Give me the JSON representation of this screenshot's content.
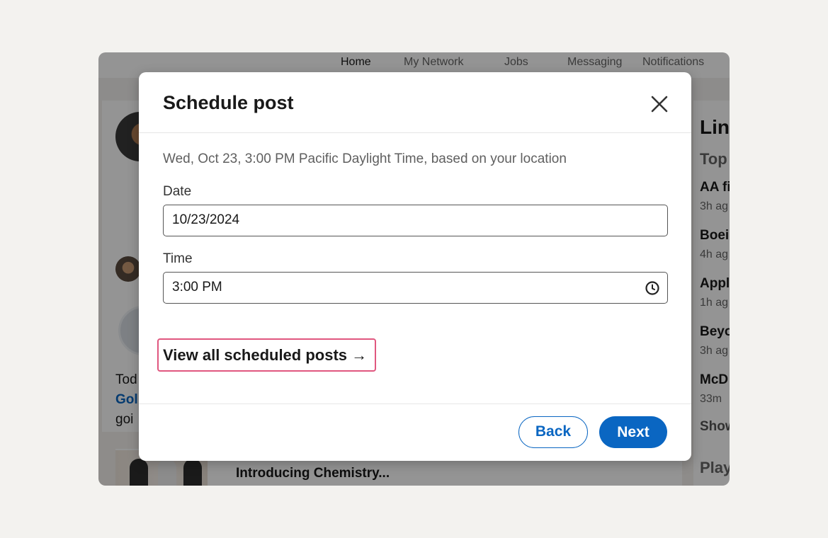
{
  "nav": {
    "items": [
      "Home",
      "My Network",
      "Jobs",
      "Messaging",
      "Notifications"
    ],
    "active": "Home"
  },
  "background": {
    "left_snippet_1": "Tod",
    "left_snippet_2": "Gol",
    "left_snippet_3": "goi",
    "feed_title": "Introducing Chemistry...",
    "right_title": "Linl",
    "right_subtitle": "Top",
    "right_items": [
      {
        "title": "AA fi",
        "time": "3h ag"
      },
      {
        "title": "Boei",
        "time": "4h ag"
      },
      {
        "title": "Appl",
        "time": "1h ag"
      },
      {
        "title": "Beyo",
        "time": "3h ag"
      },
      {
        "title": "McD",
        "time": "33m"
      }
    ],
    "right_show": "Show",
    "right_play": "Play"
  },
  "modal": {
    "title": "Schedule post",
    "timezone_note": "Wed, Oct 23, 3:00 PM Pacific Daylight Time, based on your location",
    "date_label": "Date",
    "date_value": "10/23/2024",
    "time_label": "Time",
    "time_value": "3:00 PM",
    "view_all_label": "View all scheduled posts →",
    "back_label": "Back",
    "next_label": "Next"
  },
  "colors": {
    "brand_blue": "#0a66c2",
    "highlight_border": "#e0577f"
  },
  "icons": {
    "close": "close-icon",
    "clock": "clock-icon"
  }
}
